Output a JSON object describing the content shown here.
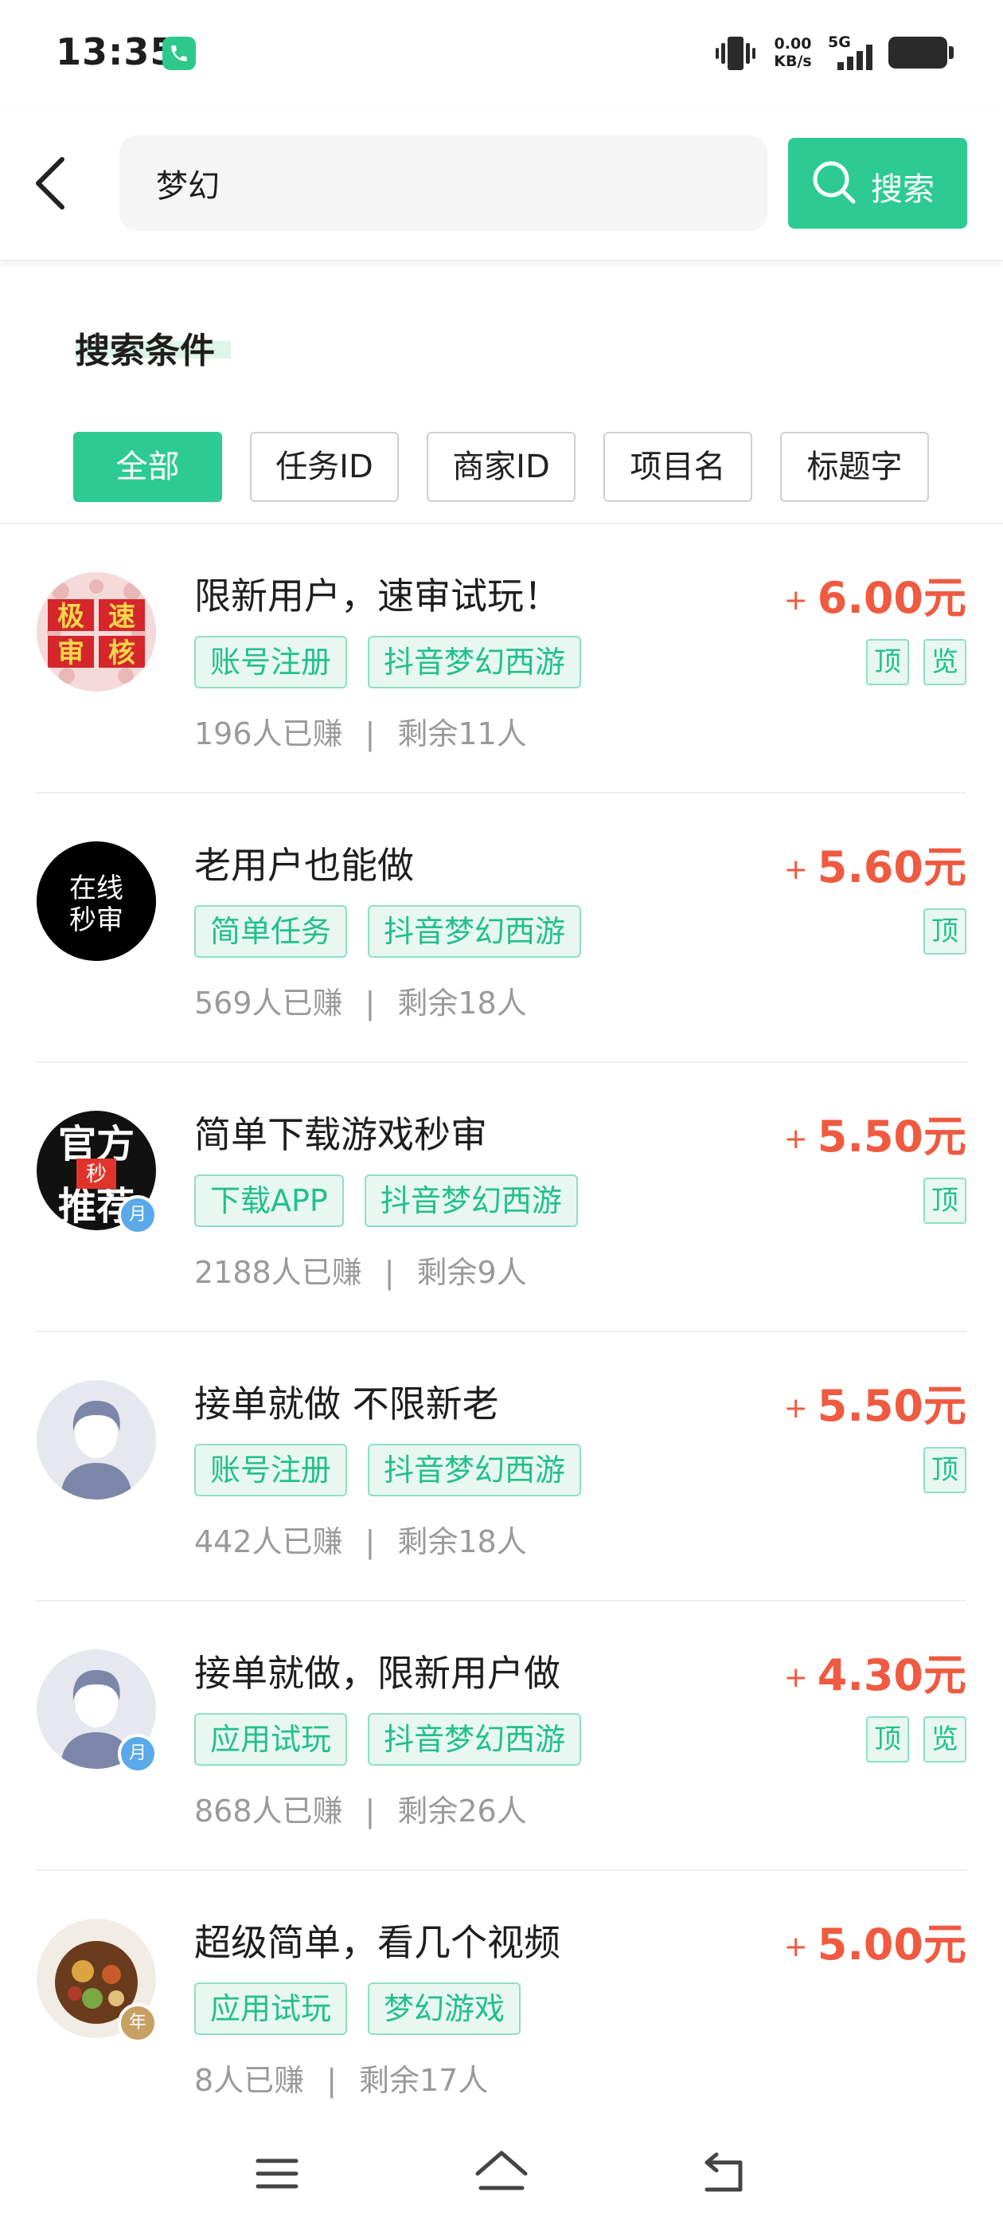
{
  "status_bar": {
    "time": "13:35",
    "net_speed_value": "0.00",
    "net_speed_unit": "KB/s",
    "network_type": "5G"
  },
  "search": {
    "query": "梦幻",
    "button_label": "搜索"
  },
  "criteria": {
    "title": "搜索条件",
    "filters": [
      {
        "label": "全部",
        "active": true
      },
      {
        "label": "任务ID",
        "active": false
      },
      {
        "label": "商家ID",
        "active": false
      },
      {
        "label": "项目名",
        "active": false
      },
      {
        "label": "标题字",
        "active": false
      }
    ]
  },
  "tasks": [
    {
      "avatar_text": "极速审核",
      "title": "限新用户，速审试玩！",
      "tags": [
        "账号注册",
        "抖音梦幻西游"
      ],
      "earned": "196人已赚",
      "remaining": "剩余11人",
      "price_prefix": "+",
      "price": "6.00元",
      "marks": [
        "顶",
        "览"
      ]
    },
    {
      "avatar_text": "在线秒审",
      "title": "老用户也能做",
      "tags": [
        "简单任务",
        "抖音梦幻西游"
      ],
      "earned": "569人已赚",
      "remaining": "剩余18人",
      "price_prefix": "+",
      "price": "5.60元",
      "marks": [
        "顶"
      ]
    },
    {
      "avatar_text": "官方推荐",
      "avatar_sub": "秒",
      "badge": "月",
      "title": "简单下载游戏秒审",
      "tags": [
        "下载APP",
        "抖音梦幻西游"
      ],
      "earned": "2188人已赚",
      "remaining": "剩余9人",
      "price_prefix": "+",
      "price": "5.50元",
      "marks": [
        "顶"
      ]
    },
    {
      "title": "接单就做 不限新老",
      "tags": [
        "账号注册",
        "抖音梦幻西游"
      ],
      "earned": "442人已赚",
      "remaining": "剩余18人",
      "price_prefix": "+",
      "price": "5.50元",
      "marks": [
        "顶"
      ]
    },
    {
      "badge": "月",
      "title": "接单就做，限新用户做",
      "tags": [
        "应用试玩",
        "抖音梦幻西游"
      ],
      "earned": "868人已赚",
      "remaining": "剩余26人",
      "price_prefix": "+",
      "price": "4.30元",
      "marks": [
        "顶",
        "览"
      ]
    },
    {
      "badge": "年",
      "title": "超级简单，看几个视频",
      "tags": [
        "应用试玩",
        "梦幻游戏"
      ],
      "earned": "8人已赚",
      "remaining": "剩余17人",
      "price_prefix": "+",
      "price": "5.00元",
      "marks": []
    }
  ],
  "colors": {
    "accent": "#2dcb92",
    "price": "#ef5a40",
    "tag_text": "#22c08a"
  }
}
